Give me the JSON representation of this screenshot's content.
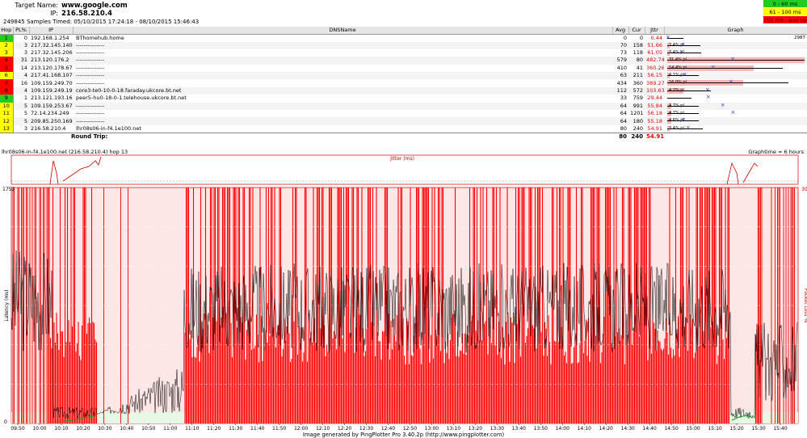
{
  "header": {
    "target_label": "Target Name:",
    "target_value": "www.google.com",
    "ip_label": "IP:",
    "ip_value": "216.58.210.4",
    "samples_text": "249845 Samples Timed:   05/10/2015 17:24:18 - 08/10/2015 15:46:43"
  },
  "legend": [
    {
      "label": "0 - 60 ms",
      "color": "#22cc22"
    },
    {
      "label": "61 - 100 ms",
      "color": "#ffff00"
    },
    {
      "label": "101 ms - and up",
      "color": "#ff0000"
    }
  ],
  "columns": {
    "hop": "Hop",
    "pl": "PL%",
    "ip": "IP",
    "dns": "DNSName",
    "avg": "Avg",
    "cur": "Cur",
    "jttr": "Jttr",
    "graph": "Graph"
  },
  "hops": [
    {
      "hop": "1",
      "pl": "0",
      "ip": "192.168.1.254",
      "dns": "BThomehub.home",
      "avg": "0",
      "cur": "0",
      "jttr": "0.44",
      "color": "#22cc22",
      "bar": 0.0,
      "pl_label": ""
    },
    {
      "hop": "2",
      "pl": "3",
      "ip": "217.32.145.140",
      "dns": "---------------",
      "avg": "70",
      "cur": "158",
      "jttr": "51.66",
      "color": "#ffff00",
      "bar": 0.02,
      "pl_label": "3.4% pl"
    },
    {
      "hop": "3",
      "pl": "3",
      "ip": "217.32.145.206",
      "dns": "---------------",
      "avg": "73",
      "cur": "118",
      "jttr": "61.05",
      "color": "#ffff00",
      "bar": 0.02,
      "pl_label": "3.4% pl"
    },
    {
      "hop": "4",
      "pl": "31",
      "ip": "213.120.176.2",
      "dns": "---------------",
      "avg": "579",
      "cur": "80",
      "jttr": "482.74",
      "color": "#ff0000",
      "bar": 1.0,
      "pl_label": "31.4% pl"
    },
    {
      "hop": "5",
      "pl": "14",
      "ip": "213.120.178.67",
      "dns": "---------------",
      "avg": "410",
      "cur": "41",
      "jttr": "360.26",
      "color": "#ff0000",
      "bar": 0.63,
      "pl_label": "14.4% pl"
    },
    {
      "hop": "6",
      "pl": "4",
      "ip": "217.41.168.107",
      "dns": "---------------",
      "avg": "63",
      "cur": "211",
      "jttr": "56.15",
      "color": "#ffff00",
      "bar": 0.02,
      "pl_label": "4.1% pl"
    },
    {
      "hop": "7",
      "pl": "16",
      "ip": "109.159.249.70",
      "dns": "---------------",
      "avg": "434",
      "cur": "360",
      "jttr": "389.27",
      "color": "#ff0000",
      "bar": 0.55,
      "pl_label": "16.0% pl"
    },
    {
      "hop": "8",
      "pl": "4",
      "ip": "109.159.249.19",
      "dns": "core3-te0-10-0-18.faraday.ukcore.bt.net",
      "avg": "112",
      "cur": "572",
      "jttr": "103.63",
      "color": "#ff0000",
      "bar": 0.12,
      "pl_label": "4.2% pl"
    },
    {
      "hop": "9",
      "pl": "1",
      "ip": "213.121.193.169",
      "dns": "peer5-hu0-18-0-1.telehouse.ukcore.bt.net",
      "avg": "33",
      "cur": "759",
      "jttr": "29.44",
      "color": "#22cc22",
      "bar": 0.0,
      "pl_label": ""
    },
    {
      "hop": "10",
      "pl": "5",
      "ip": "109.159.253.67",
      "dns": "---------------",
      "avg": "64",
      "cur": "991",
      "jttr": "55.84",
      "color": "#ffff00",
      "bar": 0.03,
      "pl_label": "4.7% pl"
    },
    {
      "hop": "11",
      "pl": "5",
      "ip": "72.14.234.249",
      "dns": "---------------",
      "avg": "64",
      "cur": "1201",
      "jttr": "56.18",
      "color": "#ffff00",
      "bar": 0.03,
      "pl_label": "4.7% pl"
    },
    {
      "hop": "12",
      "pl": "5",
      "ip": "209.85.250.169",
      "dns": "---------------",
      "avg": "64",
      "cur": "180",
      "jttr": "55.18",
      "color": "#ffff00",
      "bar": 0.03,
      "pl_label": "4.6% pl"
    },
    {
      "hop": "13",
      "pl": "3",
      "ip": "216.58.210.4",
      "dns": "lhr08s06-in-f4.1e100.net",
      "avg": "80",
      "cur": "240",
      "jttr": "54.91",
      "color": "#ffff00",
      "bar": 0.02,
      "pl_label": "3.4% pl"
    }
  ],
  "graph_scale_max": "2987",
  "round_trip": {
    "label": "Round Trip:",
    "avg": "80",
    "cur": "240",
    "jttr": "54.91"
  },
  "timeline": {
    "title": "lhr08s06-in-f4.1e100.net (216.58.210.4) hop 13",
    "graph_time": "Graphtime = 6 hours",
    "jitter_label": "Jitter (ms)",
    "latency_label": "Latency (ms)",
    "pl_label": "Packet Loss %",
    "y_top": "1752",
    "y_zero": "0",
    "pl_top": "30",
    "time_labels": [
      "09:50",
      "10:00",
      "10:10",
      "10:20",
      "10:30",
      "10:40",
      "10:50",
      "11:00",
      "11:10",
      "11:20",
      "11:30",
      "11:40",
      "11:50",
      "12:00",
      "12:10",
      "12:20",
      "12:30",
      "12:40",
      "12:50",
      "13:00",
      "13:10",
      "13:20",
      "13:30",
      "13:40",
      "13:50",
      "14:00",
      "14:10",
      "14:20",
      "14:30",
      "14:40",
      "14:50",
      "15:00",
      "15:10",
      "15:20",
      "15:30",
      "15:40"
    ]
  },
  "footer": "Image generated by PingPlotter Pro 3.40.2p (http://www.pingplotter.com)"
}
